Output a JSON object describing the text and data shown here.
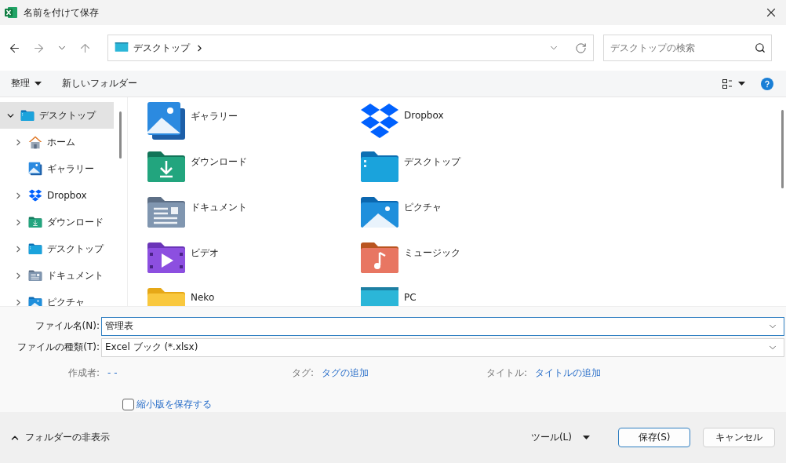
{
  "window": {
    "title": "名前を付けて保存"
  },
  "address_bar": {
    "location": "デスクトップ"
  },
  "search": {
    "placeholder": "デスクトップの検索"
  },
  "toolbar": {
    "organize": "整理",
    "new_folder": "新しいフォルダー"
  },
  "sidebar": {
    "items": [
      {
        "label": "デスクトップ",
        "kind": "desktop",
        "selected": true,
        "expandable": true,
        "expanded": true,
        "children": [
          {
            "label": "ホーム",
            "kind": "home",
            "selected": false,
            "expandable": true,
            "expanded": false
          },
          {
            "label": "ギャラリー",
            "kind": "gallery",
            "selected": false,
            "expandable": false,
            "expanded": false
          },
          {
            "label": "Dropbox",
            "kind": "dropbox",
            "selected": false,
            "expandable": true,
            "expanded": false
          },
          {
            "label": "ダウンロード",
            "kind": "download",
            "selected": false,
            "expandable": true,
            "expanded": false
          },
          {
            "label": "デスクトップ",
            "kind": "desktop",
            "selected": false,
            "expandable": true,
            "expanded": false
          },
          {
            "label": "ドキュメント",
            "kind": "documents",
            "selected": false,
            "expandable": true,
            "expanded": false
          },
          {
            "label": "ピクチャ",
            "kind": "pictures",
            "selected": false,
            "expandable": true,
            "expanded": false
          }
        ]
      }
    ]
  },
  "items": [
    {
      "label": "ギャラリー",
      "kind": "gallery"
    },
    {
      "label": "Dropbox",
      "kind": "dropbox"
    },
    {
      "label": "ダウンロード",
      "kind": "download"
    },
    {
      "label": "デスクトップ",
      "kind": "desktop"
    },
    {
      "label": "ドキュメント",
      "kind": "documents"
    },
    {
      "label": "ピクチャ",
      "kind": "pictures"
    },
    {
      "label": "ビデオ",
      "kind": "videos"
    },
    {
      "label": "ミュージック",
      "kind": "music"
    },
    {
      "label": "Neko",
      "kind": "folder"
    },
    {
      "label": "PC",
      "kind": "pc"
    }
  ],
  "form": {
    "file_name": {
      "label": "ファイル名(N):",
      "value": "管理表"
    },
    "file_type": {
      "label": "ファイルの種類(T):",
      "value": "Excel ブック (*.xlsx)"
    },
    "metadata": [
      {
        "label": "作成者:",
        "value": "- -"
      },
      {
        "label": "タグ:",
        "value": "タグの追加"
      },
      {
        "label": "タイトル:",
        "value": "タイトルの追加"
      }
    ],
    "thumbnail": {
      "label": "縮小版を保存する",
      "checked": false
    }
  },
  "footer": {
    "hide_folders": "フォルダーの非表示",
    "tools": "ツール(L)",
    "buttons": [
      {
        "label": "保存(S)",
        "kind": "primary"
      },
      {
        "label": "キャンセル",
        "kind": "secondary"
      }
    ]
  }
}
